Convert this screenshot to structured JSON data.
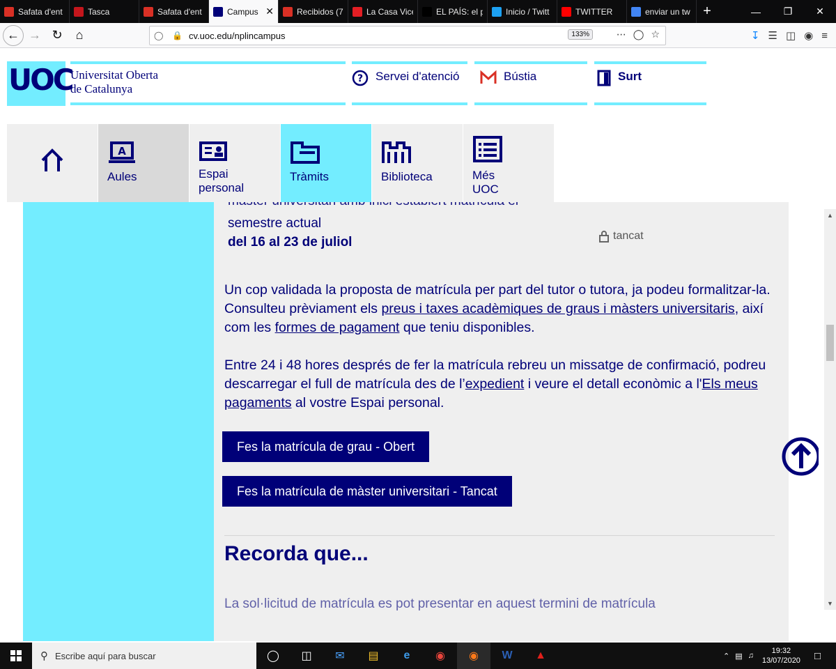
{
  "tabs": [
    {
      "label": "Safata d'ent",
      "icon": "gmail-icon",
      "color": "#d93025"
    },
    {
      "label": "Tasca",
      "icon": "tasca-icon",
      "color": "#c4161c"
    },
    {
      "label": "Safata d'ent",
      "icon": "gmail-icon",
      "color": "#d93025"
    },
    {
      "label": "Campus",
      "icon": "uoc-icon",
      "color": "#000078",
      "active": true
    },
    {
      "label": "Recibidos (7",
      "icon": "gmail-icon",
      "color": "#d93025"
    },
    {
      "label": "La Casa Vice",
      "icon": "lacasa-icon",
      "color": "#e31e24"
    },
    {
      "label": "EL PAÍS: el p",
      "icon": "elpais-icon",
      "color": "#000000"
    },
    {
      "label": "Inicio / Twitt",
      "icon": "twitter-icon",
      "color": "#1da1f2"
    },
    {
      "label": "TWITTER",
      "icon": "youtube-icon",
      "color": "#ff0000"
    },
    {
      "label": "enviar un tw",
      "icon": "google-icon",
      "color": "#4285f4"
    }
  ],
  "browser": {
    "url": "cv.uoc.edu/nplincampus",
    "zoom": "133%"
  },
  "header": {
    "logo": "UOC",
    "name_line1": "Universitat Oberta",
    "name_line2": "de Catalunya",
    "help": "Servei d'atenció",
    "mail": "Bústia",
    "logout": "Surt"
  },
  "nav": {
    "aules": "Aules",
    "espai1": "Espai",
    "espai2": "personal",
    "tramits": "Tràmits",
    "biblioteca": "Biblioteca",
    "mes1": "Més",
    "mes2": "UOC"
  },
  "content": {
    "cut_top": "màster universitari amb inici establert matrícula el",
    "semestre": "semestre actual",
    "dates": "del 16 al 23 de juliol",
    "status": "tancat",
    "p1_a": "Un cop validada la proposta de matrícula per part del tutor o tutora, ja podeu formalitzar-la. Consulteu prèviament els ",
    "p1_link1": "preus i taxes acadèmiques de graus i màsters universitaris",
    "p1_b": ", així com les ",
    "p1_link2": "formes de pagament",
    "p1_c": " que teniu disponibles.",
    "p2_a": "Entre 24 i 48 hores després de fer la matrícula rebreu un missatge de confirmació, podreu descarregar el full de matrícula des de l’",
    "p2_link1": "expedient",
    "p2_b": " i veure el detall econòmic a l'",
    "p2_link2": "Els meus pagaments",
    "p2_c": " al vostre Espai personal.",
    "btn_grau": "Fes la matrícula de grau - Obert",
    "btn_master": "Fes la matrícula de màster universitari - Tancat",
    "recorda": "Recorda que...",
    "cut_bottom": "La sol·licitud de matrícula es pot presentar en aquest termini de matrícula"
  },
  "taskbar": {
    "search_placeholder": "Escribe aquí para buscar",
    "time": "19:32",
    "date": "13/07/2020"
  },
  "colors": {
    "uoc_blue": "#000078",
    "uoc_cyan": "#73edff"
  }
}
